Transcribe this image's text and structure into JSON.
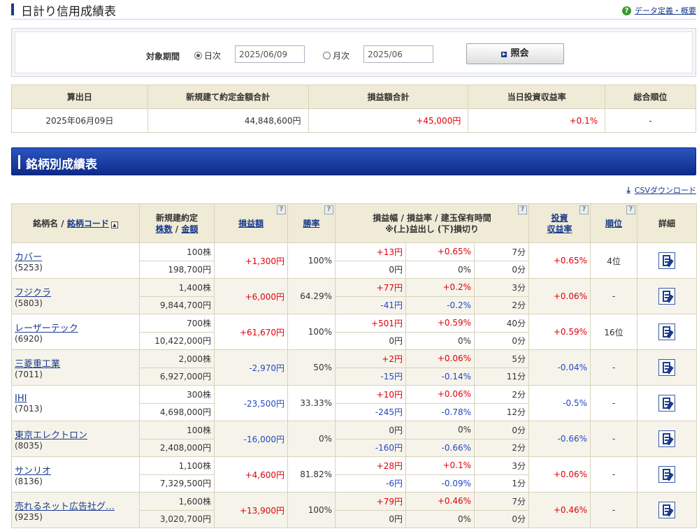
{
  "page": {
    "title": "日計り信用成績表",
    "help_link": "データ定義・概要"
  },
  "search": {
    "label": "対象期間",
    "daily_label": "日次",
    "daily_value": "2025/06/09",
    "monthly_label": "月次",
    "monthly_value": "2025/06",
    "selected": "日次",
    "query_button": "照会"
  },
  "summary": {
    "headers": [
      "算出日",
      "新規建て約定金額合計",
      "損益額合計",
      "当日投資収益率",
      "総合順位"
    ],
    "values": [
      "2025年06月09日",
      "44,848,600円",
      "+45,000円",
      "+0.1%",
      "-"
    ]
  },
  "section": {
    "title": "銘柄別成績表",
    "csv_link": "CSVダウンロード"
  },
  "table": {
    "headers": {
      "name": "銘柄名 / ",
      "code_link": "銘柄コード",
      "contract_top": "新規建約定",
      "contract_shares": "株数",
      "contract_sep": " / ",
      "contract_amount": "金額",
      "pnl": "損益額",
      "winrate": "勝率",
      "range_top": "損益幅 / 損益率 / 建玉保有時間",
      "range_bottom": "※(上)益出し (下)損切り",
      "roi_1": "投資",
      "roi_2": "収益率",
      "rank": "順位",
      "detail": "詳細"
    },
    "rows": [
      {
        "name": "カバー",
        "code": "(5253)",
        "shares": "100株",
        "amount": "198,700円",
        "pnl": "+1,300円",
        "winrate": "100%",
        "up_w": "+13円",
        "up_r": "+0.65%",
        "up_t": "7分",
        "dn_w": "0円",
        "dn_r": "0%",
        "dn_t": "0分",
        "roi": "+0.65%",
        "rank": "4位"
      },
      {
        "name": "フジクラ",
        "code": "(5803)",
        "shares": "1,400株",
        "amount": "9,844,700円",
        "pnl": "+6,000円",
        "winrate": "64.29%",
        "up_w": "+77円",
        "up_r": "+0.2%",
        "up_t": "3分",
        "dn_w": "-41円",
        "dn_r": "-0.2%",
        "dn_t": "2分",
        "roi": "+0.06%",
        "rank": "-"
      },
      {
        "name": "レーザーテック",
        "code": "(6920)",
        "shares": "700株",
        "amount": "10,422,000円",
        "pnl": "+61,670円",
        "winrate": "100%",
        "up_w": "+501円",
        "up_r": "+0.59%",
        "up_t": "40分",
        "dn_w": "0円",
        "dn_r": "0%",
        "dn_t": "0分",
        "roi": "+0.59%",
        "rank": "16位"
      },
      {
        "name": "三菱重工業",
        "code": "(7011)",
        "shares": "2,000株",
        "amount": "6,927,000円",
        "pnl": "-2,970円",
        "winrate": "50%",
        "up_w": "+2円",
        "up_r": "+0.06%",
        "up_t": "5分",
        "dn_w": "-15円",
        "dn_r": "-0.14%",
        "dn_t": "11分",
        "roi": "-0.04%",
        "rank": "-"
      },
      {
        "name": "IHI",
        "code": "(7013)",
        "shares": "300株",
        "amount": "4,698,000円",
        "pnl": "-23,500円",
        "winrate": "33.33%",
        "up_w": "+10円",
        "up_r": "+0.06%",
        "up_t": "2分",
        "dn_w": "-245円",
        "dn_r": "-0.78%",
        "dn_t": "12分",
        "roi": "-0.5%",
        "rank": "-"
      },
      {
        "name": "東京エレクトロン",
        "code": "(8035)",
        "shares": "100株",
        "amount": "2,408,000円",
        "pnl": "-16,000円",
        "winrate": "0%",
        "up_w": "0円",
        "up_r": "0%",
        "up_t": "0分",
        "dn_w": "-160円",
        "dn_r": "-0.66%",
        "dn_t": "2分",
        "roi": "-0.66%",
        "rank": "-"
      },
      {
        "name": "サンリオ",
        "code": "(8136)",
        "shares": "1,100株",
        "amount": "7,329,500円",
        "pnl": "+4,600円",
        "winrate": "81.82%",
        "up_w": "+28円",
        "up_r": "+0.1%",
        "up_t": "3分",
        "dn_w": "-6円",
        "dn_r": "-0.09%",
        "dn_t": "1分",
        "roi": "+0.06%",
        "rank": "-"
      },
      {
        "name": "売れるネット広告社グ…",
        "code": "(9235)",
        "shares": "1,600株",
        "amount": "3,020,700円",
        "pnl": "+13,900円",
        "winrate": "100%",
        "up_w": "+79円",
        "up_r": "+0.46%",
        "up_t": "7分",
        "dn_w": "0円",
        "dn_r": "0%",
        "dn_t": "0分",
        "roi": "+0.46%",
        "rank": "-"
      }
    ]
  },
  "colors": {
    "positive": "#e0000b",
    "negative": "#2446c4",
    "header_bg": "#efebd6",
    "brand": "#1d3a8a"
  }
}
